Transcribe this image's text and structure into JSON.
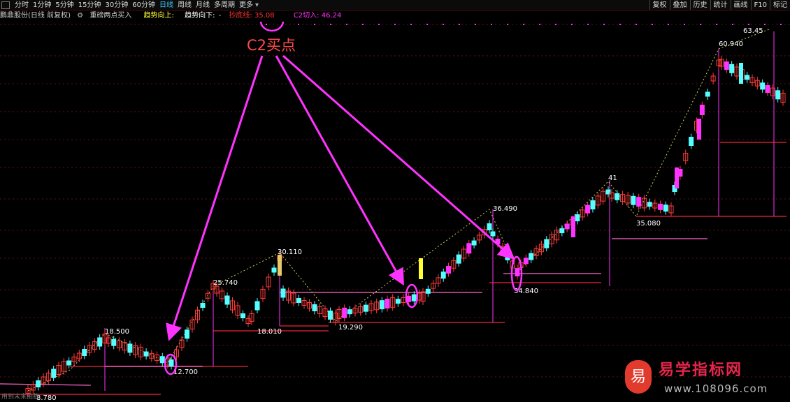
{
  "toolbar": {
    "tabs": [
      {
        "label": "分时"
      },
      {
        "label": "1分钟"
      },
      {
        "label": "5分钟"
      },
      {
        "label": "15分钟"
      },
      {
        "label": "30分钟"
      },
      {
        "label": "60分钟"
      },
      {
        "label": "日线",
        "active": true
      },
      {
        "label": "周线"
      },
      {
        "label": "月线"
      },
      {
        "label": "多周期"
      },
      {
        "label": "更多",
        "dropdown": true
      }
    ],
    "right_buttons": [
      {
        "label": "复权"
      },
      {
        "label": "叠加"
      },
      {
        "label": "历史"
      },
      {
        "label": "统计"
      },
      {
        "label": "画线"
      },
      {
        "label": "F10"
      },
      {
        "label": "标记"
      }
    ]
  },
  "infobar": {
    "stock_title": "鹏鼎股份(日线 前复权)",
    "indicator_name": "重磅两点买入",
    "trend_up": "趋势向上:",
    "trend_down": "趋势向下:",
    "trend_down_value": "-",
    "bottom_line": "抄底线: 35.08",
    "c2_value": "C2切入: 46.24"
  },
  "colors": {
    "up_candle": "#ff3a3a",
    "down_candle": "#55ffff",
    "magenta": "#ff33ff",
    "annotation": "#ff4a4a",
    "yellow_bar": "#ffff33",
    "purple": "#ff66cc",
    "gold": "#e8c766",
    "pink_bar": "#ff6f6f",
    "support": "#c81e2e"
  },
  "annotation": {
    "label": "C2买点"
  },
  "chart_data": {
    "type": "candlestick",
    "price_labels": [
      {
        "text": "8.780"
      },
      {
        "text": "18.500"
      },
      {
        "text": "12.700"
      },
      {
        "text": "25.740"
      },
      {
        "text": "30.110"
      },
      {
        "text": "18.010"
      },
      {
        "text": "19.290"
      },
      {
        "text": "36.490"
      },
      {
        "text": "34.840"
      },
      {
        "text": "41"
      },
      {
        "text": "35.080"
      },
      {
        "text": "60.940"
      },
      {
        "text": "63.45"
      }
    ]
  },
  "bottom_note": "用到末来函数",
  "watermark": {
    "badge": "易",
    "title": "易学指标网",
    "url": "www.108096.com"
  }
}
